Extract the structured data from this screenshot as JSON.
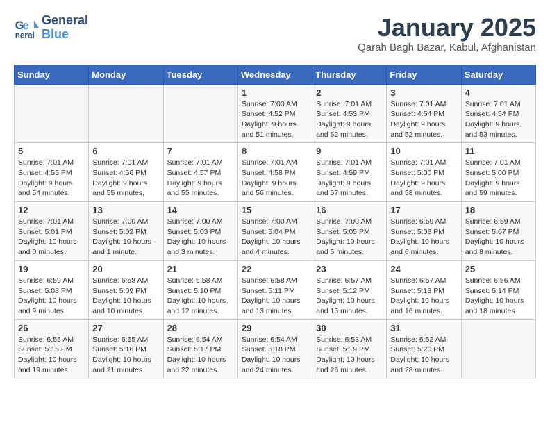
{
  "header": {
    "logo_line1": "General",
    "logo_line2": "Blue",
    "month": "January 2025",
    "location": "Qarah Bagh Bazar, Kabul, Afghanistan"
  },
  "weekdays": [
    "Sunday",
    "Monday",
    "Tuesday",
    "Wednesday",
    "Thursday",
    "Friday",
    "Saturday"
  ],
  "weeks": [
    [
      {
        "day": "",
        "info": ""
      },
      {
        "day": "",
        "info": ""
      },
      {
        "day": "",
        "info": ""
      },
      {
        "day": "1",
        "info": "Sunrise: 7:00 AM\nSunset: 4:52 PM\nDaylight: 9 hours and 51 minutes."
      },
      {
        "day": "2",
        "info": "Sunrise: 7:01 AM\nSunset: 4:53 PM\nDaylight: 9 hours and 52 minutes."
      },
      {
        "day": "3",
        "info": "Sunrise: 7:01 AM\nSunset: 4:54 PM\nDaylight: 9 hours and 52 minutes."
      },
      {
        "day": "4",
        "info": "Sunrise: 7:01 AM\nSunset: 4:54 PM\nDaylight: 9 hours and 53 minutes."
      }
    ],
    [
      {
        "day": "5",
        "info": "Sunrise: 7:01 AM\nSunset: 4:55 PM\nDaylight: 9 hours and 54 minutes."
      },
      {
        "day": "6",
        "info": "Sunrise: 7:01 AM\nSunset: 4:56 PM\nDaylight: 9 hours and 55 minutes."
      },
      {
        "day": "7",
        "info": "Sunrise: 7:01 AM\nSunset: 4:57 PM\nDaylight: 9 hours and 55 minutes."
      },
      {
        "day": "8",
        "info": "Sunrise: 7:01 AM\nSunset: 4:58 PM\nDaylight: 9 hours and 56 minutes."
      },
      {
        "day": "9",
        "info": "Sunrise: 7:01 AM\nSunset: 4:59 PM\nDaylight: 9 hours and 57 minutes."
      },
      {
        "day": "10",
        "info": "Sunrise: 7:01 AM\nSunset: 5:00 PM\nDaylight: 9 hours and 58 minutes."
      },
      {
        "day": "11",
        "info": "Sunrise: 7:01 AM\nSunset: 5:00 PM\nDaylight: 9 hours and 59 minutes."
      }
    ],
    [
      {
        "day": "12",
        "info": "Sunrise: 7:01 AM\nSunset: 5:01 PM\nDaylight: 10 hours and 0 minutes."
      },
      {
        "day": "13",
        "info": "Sunrise: 7:00 AM\nSunset: 5:02 PM\nDaylight: 10 hours and 1 minute."
      },
      {
        "day": "14",
        "info": "Sunrise: 7:00 AM\nSunset: 5:03 PM\nDaylight: 10 hours and 3 minutes."
      },
      {
        "day": "15",
        "info": "Sunrise: 7:00 AM\nSunset: 5:04 PM\nDaylight: 10 hours and 4 minutes."
      },
      {
        "day": "16",
        "info": "Sunrise: 7:00 AM\nSunset: 5:05 PM\nDaylight: 10 hours and 5 minutes."
      },
      {
        "day": "17",
        "info": "Sunrise: 6:59 AM\nSunset: 5:06 PM\nDaylight: 10 hours and 6 minutes."
      },
      {
        "day": "18",
        "info": "Sunrise: 6:59 AM\nSunset: 5:07 PM\nDaylight: 10 hours and 8 minutes."
      }
    ],
    [
      {
        "day": "19",
        "info": "Sunrise: 6:59 AM\nSunset: 5:08 PM\nDaylight: 10 hours and 9 minutes."
      },
      {
        "day": "20",
        "info": "Sunrise: 6:58 AM\nSunset: 5:09 PM\nDaylight: 10 hours and 10 minutes."
      },
      {
        "day": "21",
        "info": "Sunrise: 6:58 AM\nSunset: 5:10 PM\nDaylight: 10 hours and 12 minutes."
      },
      {
        "day": "22",
        "info": "Sunrise: 6:58 AM\nSunset: 5:11 PM\nDaylight: 10 hours and 13 minutes."
      },
      {
        "day": "23",
        "info": "Sunrise: 6:57 AM\nSunset: 5:12 PM\nDaylight: 10 hours and 15 minutes."
      },
      {
        "day": "24",
        "info": "Sunrise: 6:57 AM\nSunset: 5:13 PM\nDaylight: 10 hours and 16 minutes."
      },
      {
        "day": "25",
        "info": "Sunrise: 6:56 AM\nSunset: 5:14 PM\nDaylight: 10 hours and 18 minutes."
      }
    ],
    [
      {
        "day": "26",
        "info": "Sunrise: 6:55 AM\nSunset: 5:15 PM\nDaylight: 10 hours and 19 minutes."
      },
      {
        "day": "27",
        "info": "Sunrise: 6:55 AM\nSunset: 5:16 PM\nDaylight: 10 hours and 21 minutes."
      },
      {
        "day": "28",
        "info": "Sunrise: 6:54 AM\nSunset: 5:17 PM\nDaylight: 10 hours and 22 minutes."
      },
      {
        "day": "29",
        "info": "Sunrise: 6:54 AM\nSunset: 5:18 PM\nDaylight: 10 hours and 24 minutes."
      },
      {
        "day": "30",
        "info": "Sunrise: 6:53 AM\nSunset: 5:19 PM\nDaylight: 10 hours and 26 minutes."
      },
      {
        "day": "31",
        "info": "Sunrise: 6:52 AM\nSunset: 5:20 PM\nDaylight: 10 hours and 28 minutes."
      },
      {
        "day": "",
        "info": ""
      }
    ]
  ]
}
